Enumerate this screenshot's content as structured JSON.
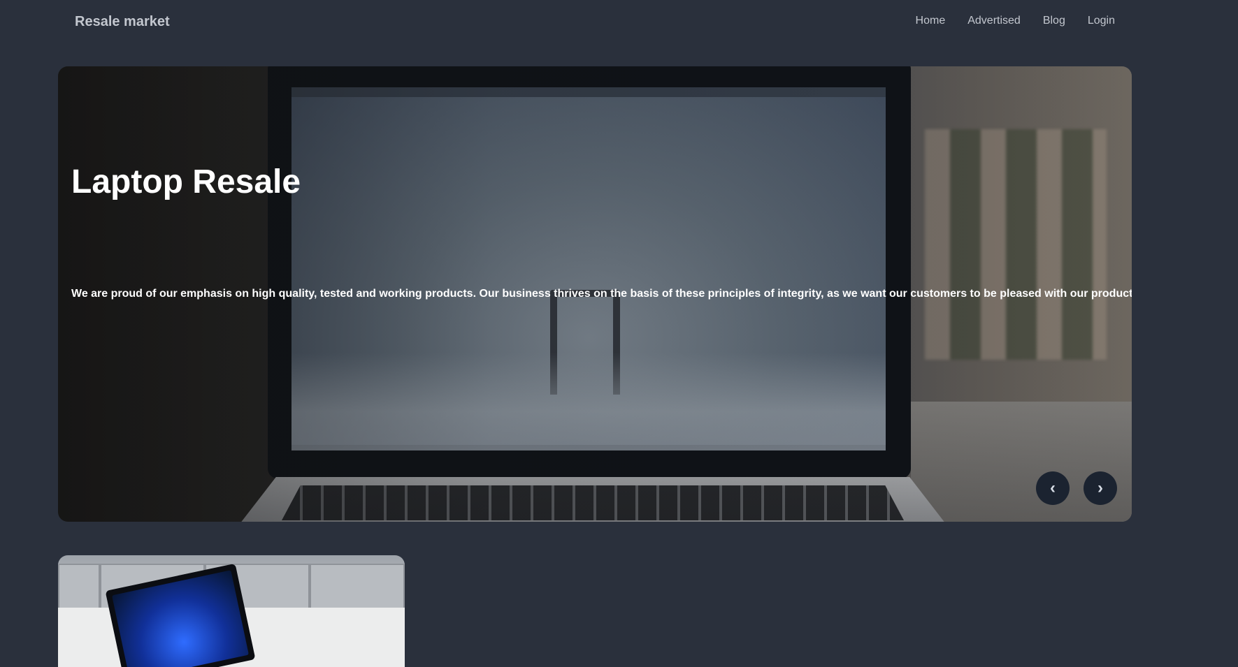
{
  "navbar": {
    "brand": "Resale market",
    "links": [
      "Home",
      "Advertised",
      "Blog",
      "Login"
    ]
  },
  "hero": {
    "title": "Laptop Resale",
    "text": "We are proud of our emphasis on high quality, tested and working products. Our business thrives on the basis of these principles of integrity, as we want our customers to be pleased with our products.",
    "prev_label": "‹",
    "next_label": "›"
  }
}
